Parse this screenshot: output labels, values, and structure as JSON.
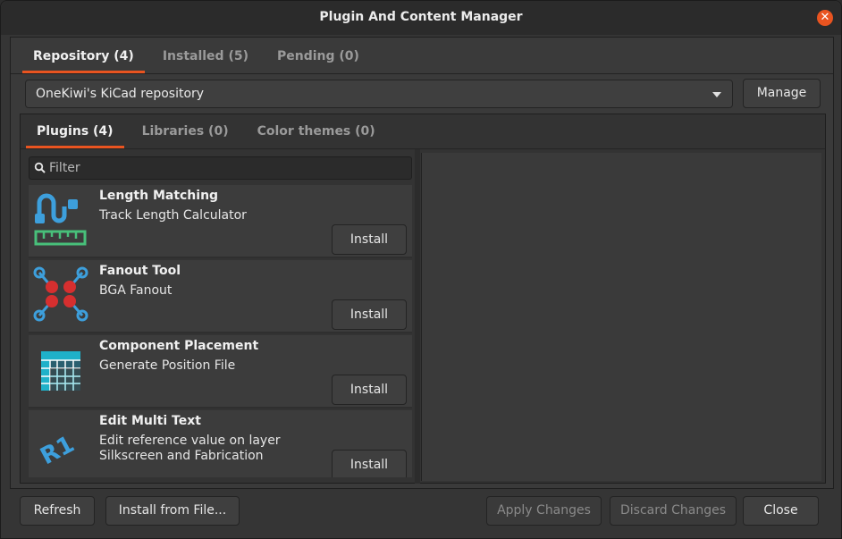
{
  "window": {
    "title": "Plugin And Content Manager"
  },
  "top_tabs": [
    {
      "label": "Repository (4)",
      "active": true
    },
    {
      "label": "Installed (5)",
      "active": false
    },
    {
      "label": "Pending (0)",
      "active": false
    }
  ],
  "repository": {
    "selected": "OneKiwi's KiCad repository",
    "manage_label": "Manage"
  },
  "inner_tabs": [
    {
      "label": "Plugins (4)",
      "active": true
    },
    {
      "label": "Libraries (0)",
      "active": false
    },
    {
      "label": "Color themes (0)",
      "active": false
    }
  ],
  "filter": {
    "placeholder": "Filter",
    "value": ""
  },
  "plugins": [
    {
      "name": "Length Matching",
      "description": "Track Length Calculator",
      "button": "Install",
      "icon": "length-matching-icon"
    },
    {
      "name": "Fanout Tool",
      "description": "BGA Fanout",
      "button": "Install",
      "icon": "fanout-icon"
    },
    {
      "name": "Component Placement",
      "description": "Generate Position File",
      "button": "Install",
      "icon": "grid-table-icon"
    },
    {
      "name": "Edit Multi Text",
      "description": "Edit reference value on layer Silkscreen and Fabrication",
      "button": "Install",
      "icon": "r1-text-icon"
    }
  ],
  "footer": {
    "refresh": "Refresh",
    "install_from_file": "Install from File...",
    "apply": "Apply Changes",
    "discard": "Discard Changes",
    "close": "Close"
  },
  "colors": {
    "accent": "#e95420",
    "icon_blue": "#3d9fdc",
    "icon_red": "#d62f2f",
    "icon_green": "#48c07a",
    "icon_teal": "#1fb1c9"
  }
}
